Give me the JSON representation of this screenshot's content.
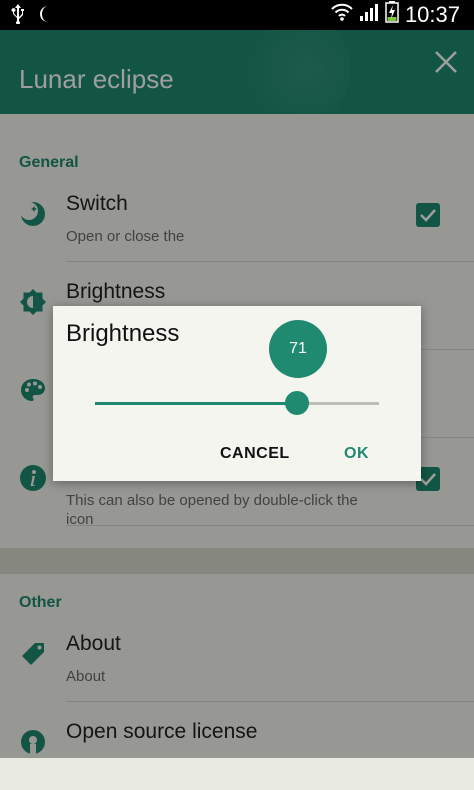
{
  "status_bar": {
    "time": "10:37",
    "left_icons": [
      "usb-icon",
      "moon-icon"
    ],
    "right_icons": [
      "wifi-icon",
      "signal-icon",
      "battery-charging-icon"
    ]
  },
  "toolbar": {
    "title": "Lunar eclipse",
    "close_icon": "close-icon"
  },
  "sections": [
    {
      "title": "General",
      "items": [
        {
          "title": "Switch",
          "subtitle": "Open or close the",
          "icon": "moon-icon",
          "checked": true
        },
        {
          "title": "Brightness",
          "subtitle": "",
          "icon": "brightness-icon"
        },
        {
          "title": "",
          "subtitle": "",
          "icon": "palette-icon"
        },
        {
          "title": "",
          "subtitle": "This can also be opened by double-click the icon",
          "icon": "info-icon",
          "checked": true
        }
      ]
    },
    {
      "title": "Other",
      "items": [
        {
          "title": "About",
          "subtitle": "About",
          "icon": "tag-icon"
        },
        {
          "title": "Open source license",
          "subtitle": "",
          "icon": "open-source-icon"
        }
      ]
    }
  ],
  "dialog": {
    "title": "Brightness",
    "value": "71",
    "slider_fraction": 0.71,
    "cancel_label": "CANCEL",
    "ok_label": "OK"
  },
  "colors": {
    "accent": "#1f8a6f",
    "background": "#f4f5ef",
    "divider": "#d7d9d0",
    "scrim": "rgba(0,0,0,0.38)"
  }
}
